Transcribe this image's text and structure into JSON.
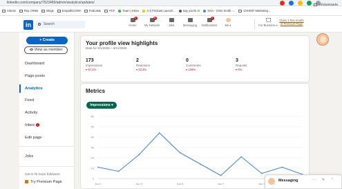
{
  "browser": {
    "url": "linkedin.com/company/7523469/admin/analytics/updates/",
    "bookmarks": [
      {
        "label": "Clients",
        "type": "folder"
      },
      {
        "label": "Rep CRMs",
        "type": "folder"
      },
      {
        "label": "Blogs",
        "type": "folder"
      },
      {
        "label": "EmpathicCRM",
        "type": "folder"
      },
      {
        "label": "Podcasts",
        "type": "folder"
      },
      {
        "label": "PCF",
        "type": "folder"
      },
      {
        "label": "Team | Inbox",
        "type": "site",
        "color": "#34a853"
      },
      {
        "label": "A-Z Podcast Launch...",
        "type": "site",
        "color": "#fbbc04"
      },
      {
        "label": "Say you're AI",
        "type": "site",
        "color": "#555555"
      },
      {
        "label": "SOA - Chris Smith -...",
        "type": "site",
        "color": "#4285f4"
      },
      {
        "label": "CHIXMT Marketing...",
        "type": "folder"
      }
    ],
    "all_bookmarks": "All Bookmarks"
  },
  "nav": {
    "logo": "in",
    "search_placeholder": "Search",
    "items": [
      {
        "label": "Home",
        "icon": "home-icon",
        "badge": "1"
      },
      {
        "label": "My Network",
        "icon": "network-icon",
        "badge": "8"
      },
      {
        "label": "Jobs",
        "icon": "jobs-icon",
        "badge": ""
      },
      {
        "label": "Messaging",
        "icon": "messaging-icon",
        "badge": ""
      },
      {
        "label": "Notifications",
        "icon": "bell-icon",
        "badge": "3"
      },
      {
        "label": "Me ▾",
        "icon": "avatar-icon",
        "badge": ""
      },
      {
        "label": "For Business ▾",
        "icon": "grid-icon",
        "badge": ""
      }
    ],
    "premium_line1": "Claim 1 free month",
    "premium_line2": "of Premium Page"
  },
  "leftnav": {
    "create": "+ Create",
    "view_as_member": "View as member",
    "items": [
      {
        "label": "Dashboard"
      },
      {
        "label": "Page posts"
      },
      {
        "label": "Analytics"
      },
      {
        "label": "Feed"
      },
      {
        "label": "Activity"
      },
      {
        "label": "Inbox"
      },
      {
        "label": "Edit page"
      },
      {
        "label": "Jobs"
      }
    ],
    "followers_note": "Get 8.7k more followers",
    "try_premium": "Try Premium Page"
  },
  "highlights": {
    "title": "Your profile view highlights",
    "date_range": "Data for 6/1/2025 – 6/11/2025",
    "stats": [
      {
        "value": "173",
        "label": "Impressions",
        "change": "▾ 97.1%"
      },
      {
        "value": "2",
        "label": "Reactions",
        "change": "▾ 33.3%"
      },
      {
        "value": "0",
        "label": "Comments",
        "change": "▾ 100%"
      },
      {
        "value": "3",
        "label": "Reposts",
        "change": "▾ 0%"
      }
    ]
  },
  "metrics": {
    "title": "Metrics",
    "dropdown": "Impressions ▾"
  },
  "chart_data": {
    "type": "line",
    "xlabel": "",
    "ylabel": "",
    "ylim": [
      0,
      60
    ],
    "yticks": [
      0,
      10,
      20,
      30,
      40,
      50,
      60
    ],
    "x": [
      "Jun 1",
      "Jun 2",
      "Jun 3",
      "Jun 4",
      "Jun 5",
      "Jun 6",
      "Jun 7",
      "Jun 8",
      "Jun 9",
      "Jun 10",
      "Jun 11"
    ],
    "xtick_labels": [
      "Jun 1",
      "Jun 3",
      "Jun 5",
      "Jun 7",
      "Jun 9"
    ],
    "series": [
      {
        "values": [
          11,
          7,
          23,
          44,
          25,
          14,
          3,
          21,
          5,
          11,
          4
        ],
        "color": "#4a86d6"
      }
    ],
    "grid": true
  },
  "messaging": {
    "label": "Messaging",
    "ctrl_more": "···",
    "ctrl_compose": "✎",
    "ctrl_collapse": "⌃"
  }
}
